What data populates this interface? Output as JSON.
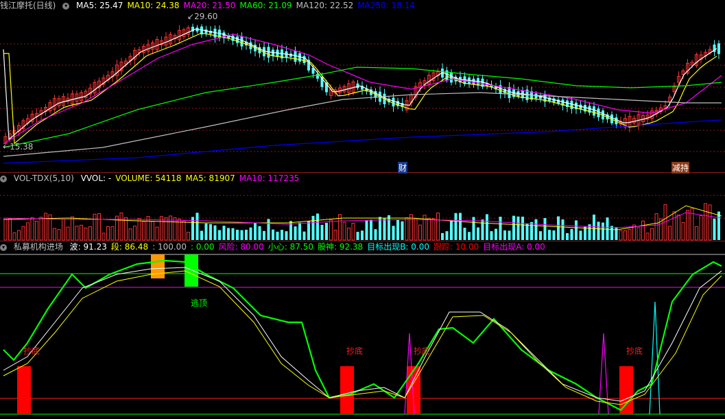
{
  "main_panel": {
    "title": "钱江摩托(日线)",
    "indicators": [
      {
        "label": "MA5: 25.47",
        "color": "#ffffff"
      },
      {
        "label": "MA10: 24.38",
        "color": "#ffff00"
      },
      {
        "label": "MA20: 21.50",
        "color": "#ff00ff"
      },
      {
        "label": "MA60: 21.09",
        "color": "#00ff00"
      },
      {
        "label": "MA120: 22.52",
        "color": "#c0c0c0"
      },
      {
        "label": "MA250: 18.14",
        "color": "#0000ff"
      }
    ],
    "high_marker": "29.60",
    "low_marker": "15.38",
    "event_tags": [
      "财",
      "减持"
    ]
  },
  "volume_panel": {
    "title": "VOL-TDX(5,10)",
    "indicators": [
      {
        "label": "VVOL: -",
        "color": "#ffffff"
      },
      {
        "label": "VOLUME: 54118",
        "color": "#ffff00"
      },
      {
        "label": "MA5: 81907",
        "color": "#ffff00"
      },
      {
        "label": "MA10: 117235",
        "color": "#ff00ff"
      }
    ]
  },
  "indicator_panel": {
    "title": "私募机构进场",
    "indicators": [
      {
        "label": "波: 91.23",
        "color": "#ffffff"
      },
      {
        "label": "段: 86.48",
        "color": "#ffff00"
      },
      {
        "label": ": 100.00",
        "color": "#c0c0c0"
      },
      {
        "label": ": 0.00",
        "color": "#00ff00"
      },
      {
        "label": "风险: 80.00",
        "color": "#ff00ff"
      },
      {
        "label": "小心: 87.50",
        "color": "#00ff00"
      },
      {
        "label": "股神: 92.38",
        "color": "#00ff00"
      },
      {
        "label": "目标出现B: 0.00",
        "color": "#00ffff"
      },
      {
        "label": "跟踪: 10.00",
        "color": "#ff0000"
      },
      {
        "label": "目标出现A: 0.00",
        "color": "#ff00ff"
      }
    ],
    "signals": {
      "bottom_labels": [
        "抄底",
        "抄底",
        "抄底",
        "抄底"
      ],
      "top_label": "逃顶"
    }
  },
  "colors": {
    "up_candle": "#ff3232",
    "down_candle": "#54ffff",
    "grid": "#8b1a1a",
    "ma5": "#ffffff",
    "ma10": "#ffff00",
    "ma20": "#ff00ff",
    "ma60": "#00ff00",
    "ma120": "#c0c0c0",
    "ma250": "#0000ff"
  }
}
